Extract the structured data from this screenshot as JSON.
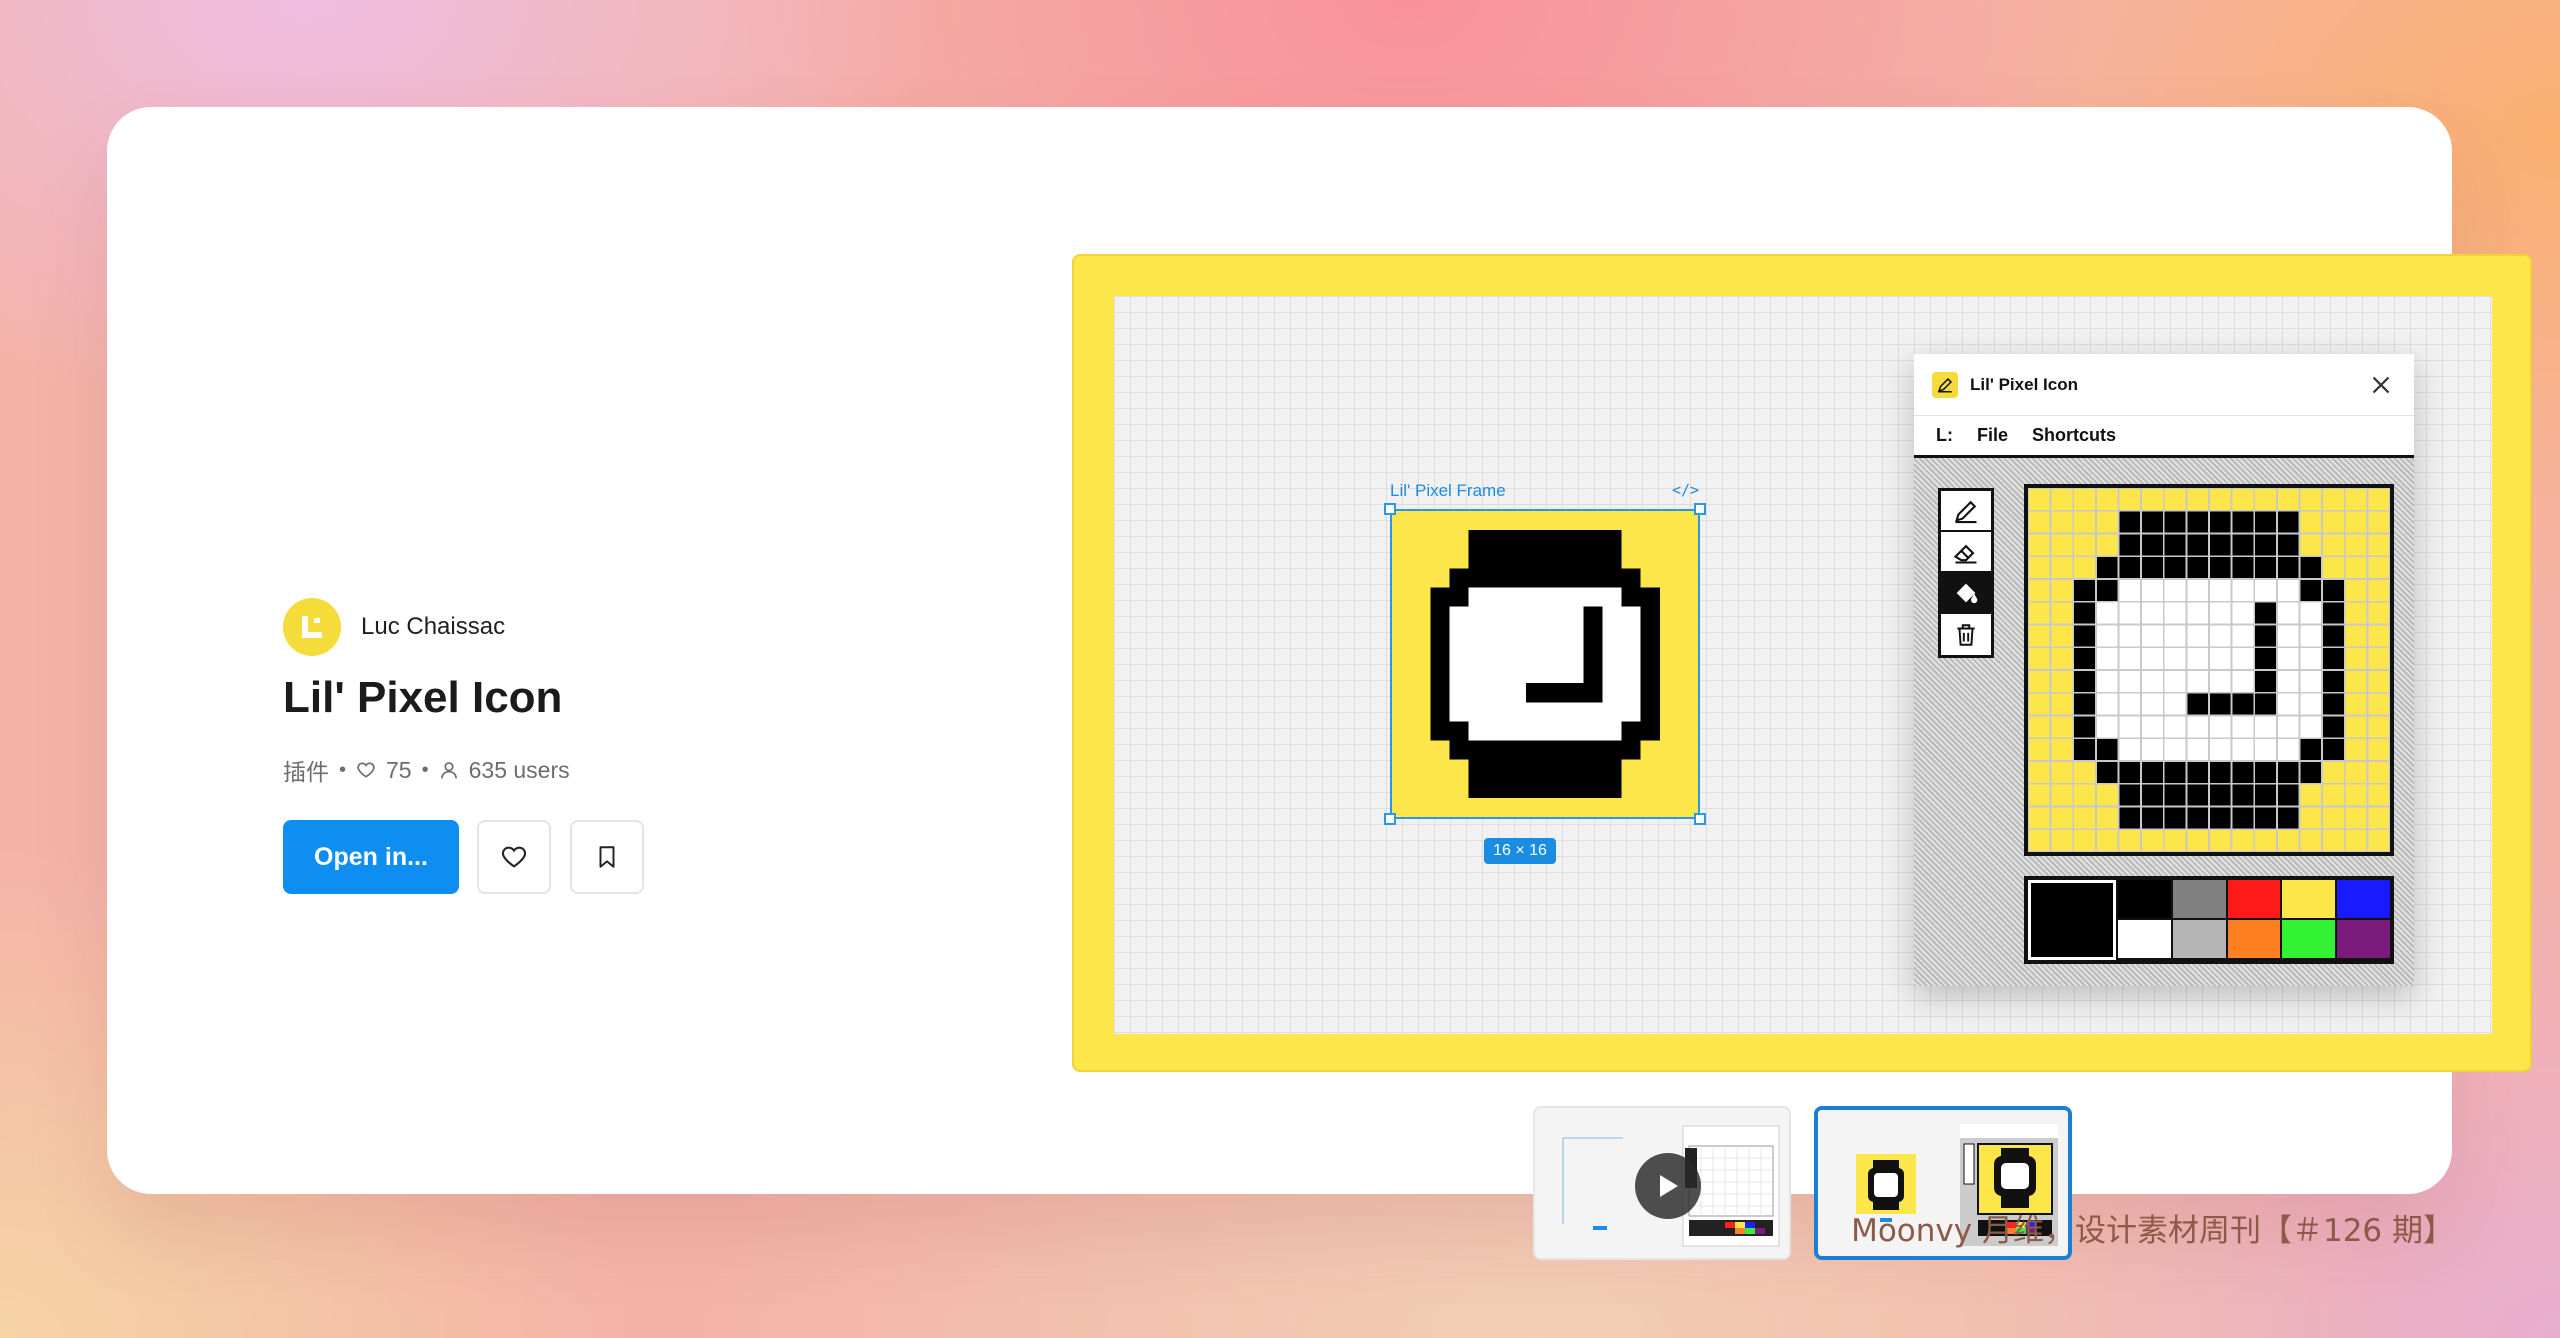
{
  "author": {
    "name": "Luc Chaissac"
  },
  "plugin": {
    "title": "Lil' Pixel Icon",
    "type_label": "插件",
    "likes": "75",
    "users": "635 users"
  },
  "actions": {
    "open_label": "Open in..."
  },
  "preview": {
    "frame_label": "Lil' Pixel Frame",
    "code_label": "</>",
    "size_badge": "16 × 16",
    "window": {
      "title": "Lil' Pixel Icon",
      "menu_logo": "L:",
      "menu": [
        "File",
        "Shortcuts"
      ],
      "tools": [
        "pencil-icon",
        "eraser-icon",
        "fill-bucket-icon",
        "trash-icon"
      ],
      "palette_colors": [
        "#000000",
        "#808080",
        "#ff1a1a",
        "#fde64a",
        "#1a1aff",
        "#ffffff",
        "#b5b5b5",
        "#ff8020",
        "#33f233",
        "#7a1a7a"
      ]
    }
  },
  "thumbnails": [
    {
      "label": "video-thumbnail",
      "play_icon": "play-icon"
    },
    {
      "label": "image-thumbnail"
    }
  ],
  "footer": {
    "credit": "Moonvy 月维，设计素材周刊【＃126 期】"
  },
  "colors": {
    "accent": "#0d8ef0",
    "brand_yellow": "#fde64a"
  }
}
